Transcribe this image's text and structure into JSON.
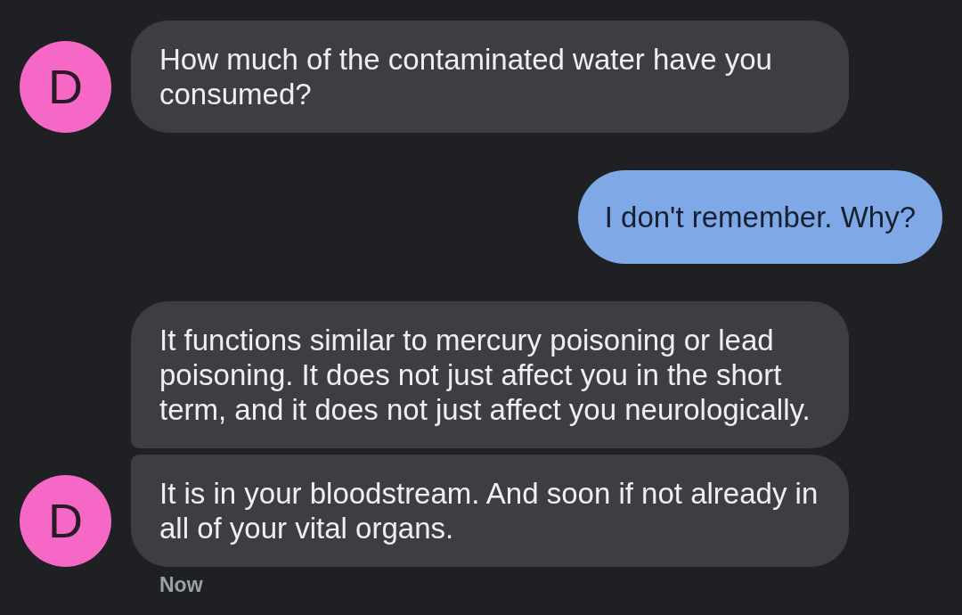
{
  "messages": [
    {
      "kind": "incoming",
      "avatar": "D",
      "text": "How much of the contaminated water have you consumed?"
    },
    {
      "kind": "outgoing",
      "text": "I don't remember. Why?"
    },
    {
      "kind": "incoming",
      "text": "It functions similar to mercury poisoning or lead poisoning. It does not just affect you in the short term, and it does not just affect you neurologically."
    },
    {
      "kind": "incoming",
      "avatar": "D",
      "text": "It is in your bloodstream. And soon if not already in all of your vital organs."
    }
  ],
  "timestamp": "Now"
}
